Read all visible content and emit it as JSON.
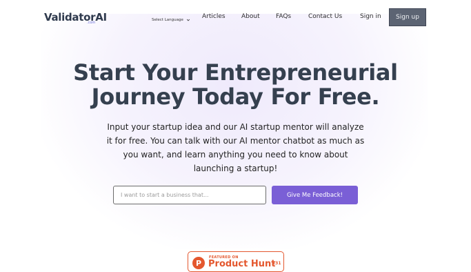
{
  "brand": {
    "name": "ValidatorAI",
    "subtitle": ".com"
  },
  "nav": {
    "language_select": "Select Language",
    "links": [
      "Articles",
      "About",
      "FAQs",
      "Contact Us",
      "Sign in"
    ],
    "signup_label": "Sign up"
  },
  "hero": {
    "title_line1": "Start Your Entrepreneurial",
    "title_line2": "Journey Today For Free.",
    "description": "Input your startup idea and our AI startup mentor will analyze it for free. You can talk with our AI mentor chatbot as much as you want, and learn anything you need to know about launching a startup!",
    "input_placeholder": "I want to start a business that...",
    "input_value": "",
    "button_label": "Give Me Feedback!"
  },
  "product_hunt": {
    "featured_label": "FEATURED ON",
    "name": "Product Hunt",
    "logo_letter": "P",
    "count": "131"
  },
  "colors": {
    "accent": "#7a5fd6",
    "heading": "#35404f",
    "signup_bg": "#5c6473",
    "product_hunt": "#e4572e"
  }
}
